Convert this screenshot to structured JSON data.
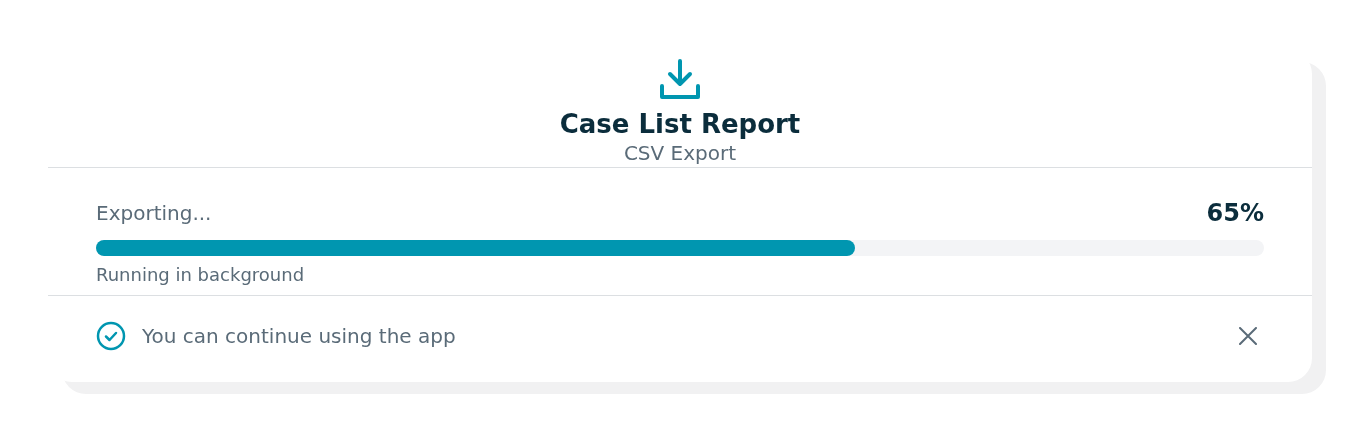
{
  "header": {
    "title": "Case List Report",
    "subtitle": "CSV Export"
  },
  "progress": {
    "label": "Exporting...",
    "percent": "65%",
    "level": 0.65,
    "note": "Running in background"
  },
  "footer": {
    "message": "You can continue using the app"
  }
}
